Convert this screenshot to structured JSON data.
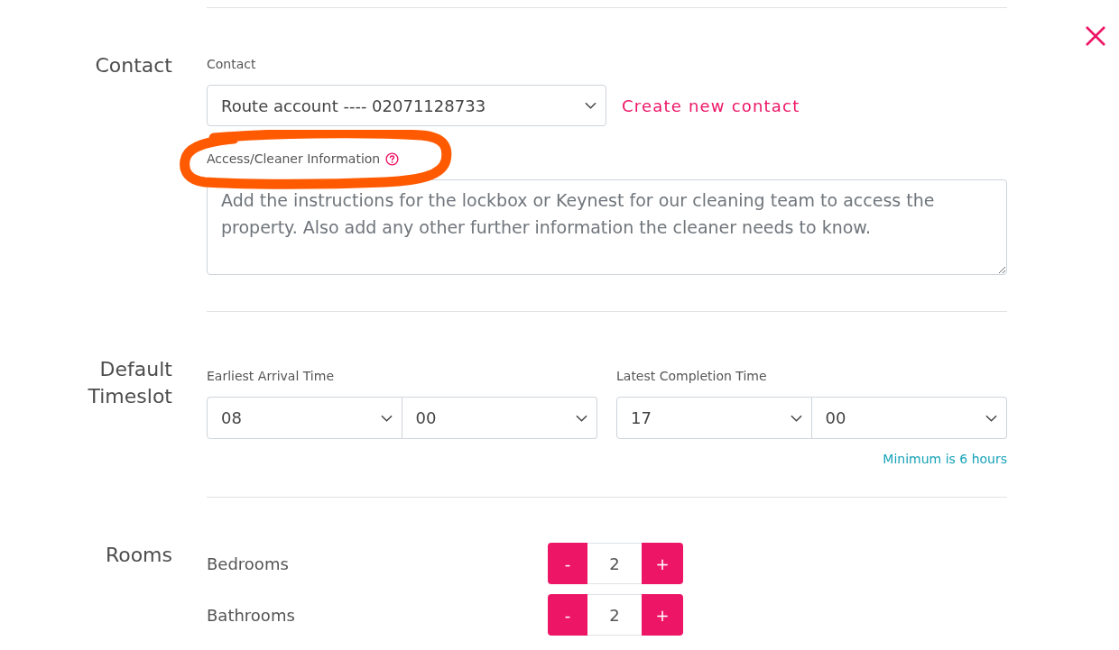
{
  "sections": [
    {
      "kind": "contact",
      "title": "Contact",
      "contact_select": {
        "label": "Contact",
        "value": "Route account ---- 02071128733"
      },
      "create_link": "Create new contact",
      "access_info": {
        "label": "Access/Cleaner Information",
        "circled": true,
        "placeholder": "Add the instructions for the lockbox or Keynest for our cleaning team to access the property. Also add any other further information the cleaner needs to know."
      }
    },
    {
      "kind": "timeslot",
      "title": "Default Timeslot",
      "times": [
        {
          "label": "Earliest Arrival Time",
          "hour": "08",
          "minute": "00"
        },
        {
          "label": "Latest Completion Time",
          "hour": "17",
          "minute": "00"
        }
      ],
      "hint": "Minimum is 6 hours"
    },
    {
      "kind": "rooms",
      "title": "Rooms",
      "rows": [
        {
          "label": "Bedrooms",
          "decrement": "-",
          "value": "2",
          "increment": "+"
        },
        {
          "label": "Bathrooms",
          "decrement": "-",
          "value": "2",
          "increment": "+"
        }
      ]
    }
  ]
}
